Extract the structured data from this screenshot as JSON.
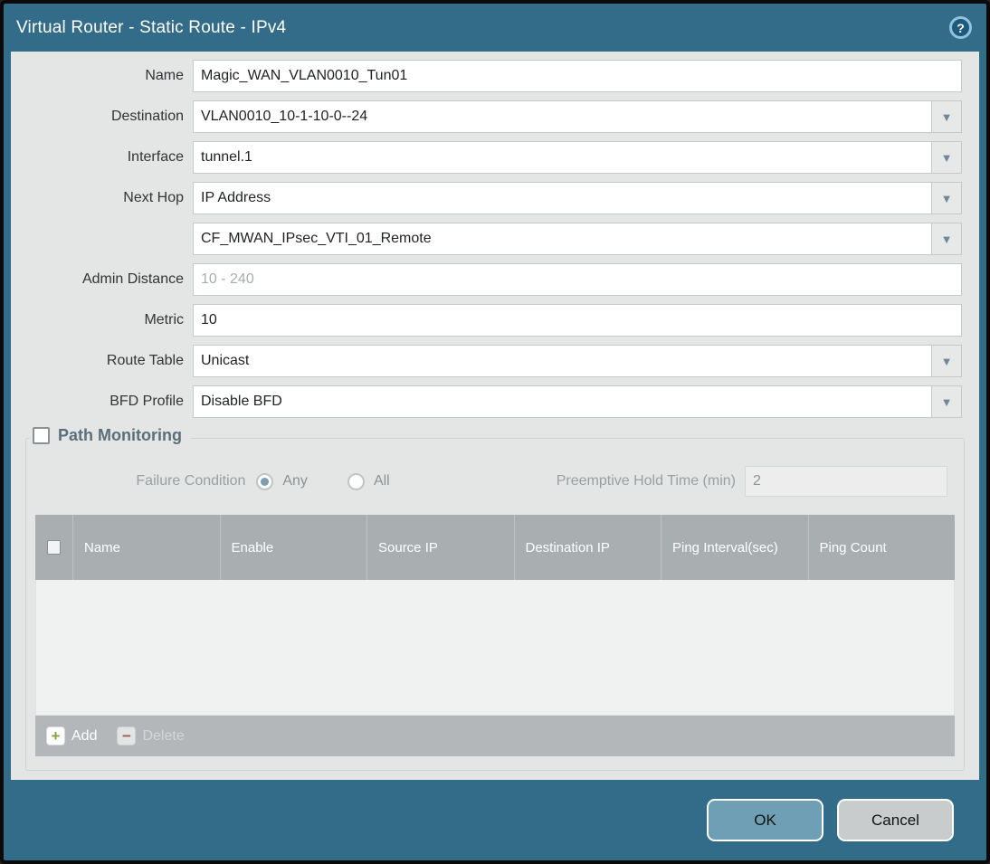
{
  "dialog": {
    "title": "Virtual Router - Static Route - IPv4"
  },
  "icons": {
    "help": "?",
    "dropdown": "▼",
    "add": "+",
    "delete": "−"
  },
  "form": {
    "name": {
      "label": "Name",
      "value": "Magic_WAN_VLAN0010_Tun01"
    },
    "destination": {
      "label": "Destination",
      "value": "VLAN0010_10-1-10-0--24"
    },
    "interface": {
      "label": "Interface",
      "value": "tunnel.1"
    },
    "next_hop": {
      "label": "Next Hop",
      "value": "IP Address"
    },
    "next_hop_address": {
      "value": "CF_MWAN_IPsec_VTI_01_Remote"
    },
    "admin_distance": {
      "label": "Admin Distance",
      "placeholder": "10 - 240",
      "value": ""
    },
    "metric": {
      "label": "Metric",
      "value": "10"
    },
    "route_table": {
      "label": "Route Table",
      "value": "Unicast"
    },
    "bfd_profile": {
      "label": "BFD Profile",
      "value": "Disable BFD"
    }
  },
  "path_monitoring": {
    "title": "Path Monitoring",
    "enabled": false,
    "failure_condition_label": "Failure Condition",
    "radio_any_label": "Any",
    "radio_all_label": "All",
    "radio_selected": "Any",
    "preemptive_label": "Preemptive Hold Time (min)",
    "preemptive_value": "2",
    "table": {
      "columns": [
        "Name",
        "Enable",
        "Source IP",
        "Destination IP",
        "Ping Interval(sec)",
        "Ping Count"
      ],
      "rows": []
    },
    "add_label": "Add",
    "delete_label": "Delete"
  },
  "footer": {
    "ok_label": "OK",
    "cancel_label": "Cancel"
  },
  "colors": {
    "frame_teal": "#336c88",
    "content_bg": "#e4e5e5",
    "table_header_bg": "#a9aeb1",
    "ok_button": "#6f9fb5",
    "cancel_button": "#c9cccd",
    "add_plus": "#8aa23c",
    "delete_minus": "#a05a52"
  }
}
